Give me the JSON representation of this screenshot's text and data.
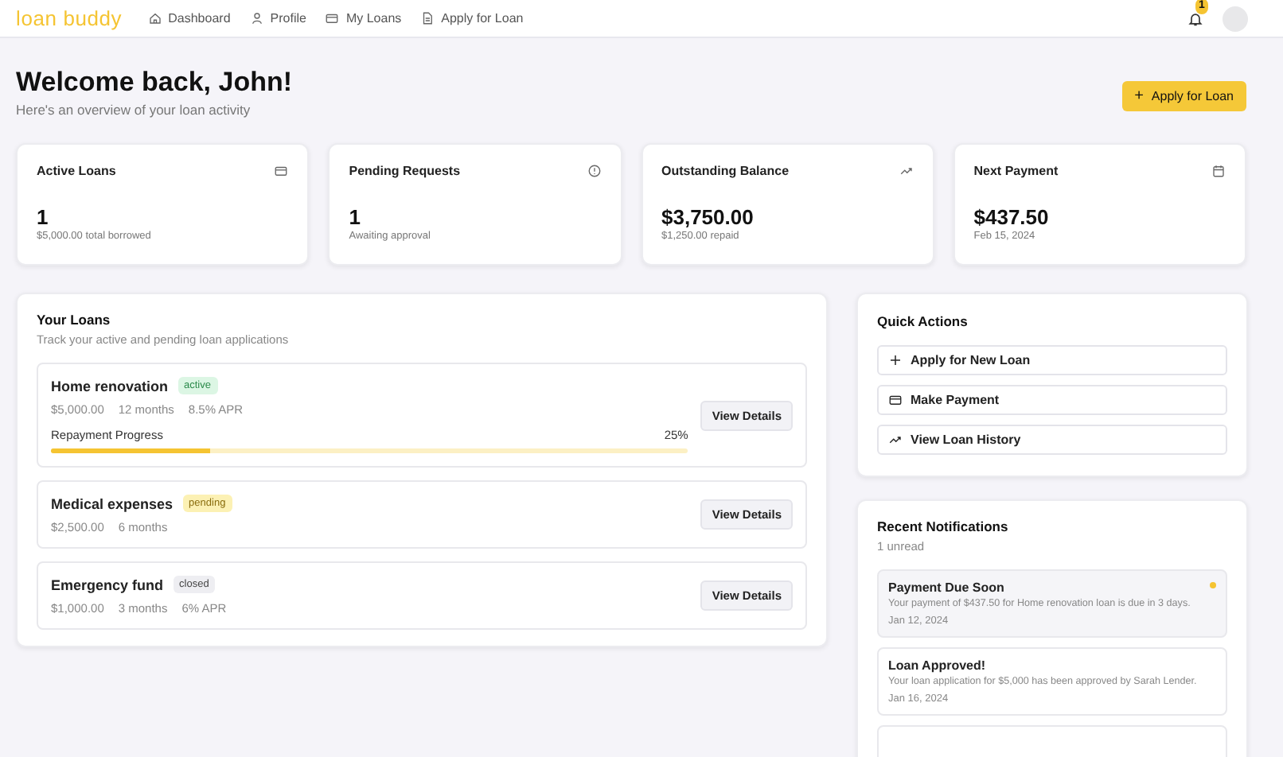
{
  "logo": "loan buddy",
  "nav": [
    {
      "label": "Dashboard",
      "kind": "home"
    },
    {
      "label": "Profile",
      "kind": "user"
    },
    {
      "label": "My Loans",
      "kind": "card"
    },
    {
      "label": "Apply for Loan",
      "kind": "file"
    }
  ],
  "notification_count": "1",
  "heading": "Welcome back, John!",
  "subheading": "Here's an overview of your loan activity",
  "apply_button": {
    "icon": "+",
    "label": "Apply for Loan"
  },
  "stats": [
    {
      "title": "Active Loans",
      "kind": "card",
      "value": "1",
      "note": "$5,000.00 total borrowed"
    },
    {
      "title": "Pending Requests",
      "kind": "info",
      "value": "1",
      "note": "Awaiting approval"
    },
    {
      "title": "Outstanding Balance",
      "kind": "trend",
      "value": "$3,750.00",
      "note": "$1,250.00 repaid"
    },
    {
      "title": "Next Payment",
      "kind": "calendar",
      "value": "$437.50",
      "note": "Feb 15, 2024"
    }
  ],
  "loans_panel": {
    "title": "Your Loans",
    "subtitle": "Track your active and pending loan applications",
    "loans": [
      {
        "name": "Home renovation",
        "status": "active",
        "kind": "active",
        "details": [
          "$5,000.00",
          "12 months",
          "8.5% APR"
        ],
        "progress": {
          "label": "Repayment Progress",
          "reading": "25%",
          "level": 0.25
        },
        "button": "View Details"
      },
      {
        "name": "Medical expenses",
        "status": "pending",
        "kind": "pending",
        "details": [
          "$2,500.00",
          "6 months"
        ],
        "button": "View Details"
      },
      {
        "name": "Emergency fund",
        "status": "closed",
        "kind": "closed",
        "details": [
          "$1,000.00",
          "3 months",
          "6% APR"
        ],
        "button": "View Details"
      }
    ]
  },
  "quick_actions": {
    "title": "Quick Actions",
    "items": [
      {
        "kind": "plus",
        "label": "Apply for New Loan"
      },
      {
        "kind": "card",
        "label": "Make Payment"
      },
      {
        "kind": "trend",
        "label": "View Loan History"
      }
    ]
  },
  "notifications": {
    "title": "Recent Notifications",
    "count": "1 unread",
    "items": [
      {
        "title": "Payment Due Soon",
        "text": "Your payment of $437.50 for Home renovation loan is due in 3 days.",
        "date": "Jan 12, 2024",
        "unread": true
      },
      {
        "title": "Loan Approved!",
        "text": "Your loan application for $5,000 has been approved by Sarah Lender.",
        "date": "Jan 16, 2024",
        "unread": false
      }
    ]
  }
}
